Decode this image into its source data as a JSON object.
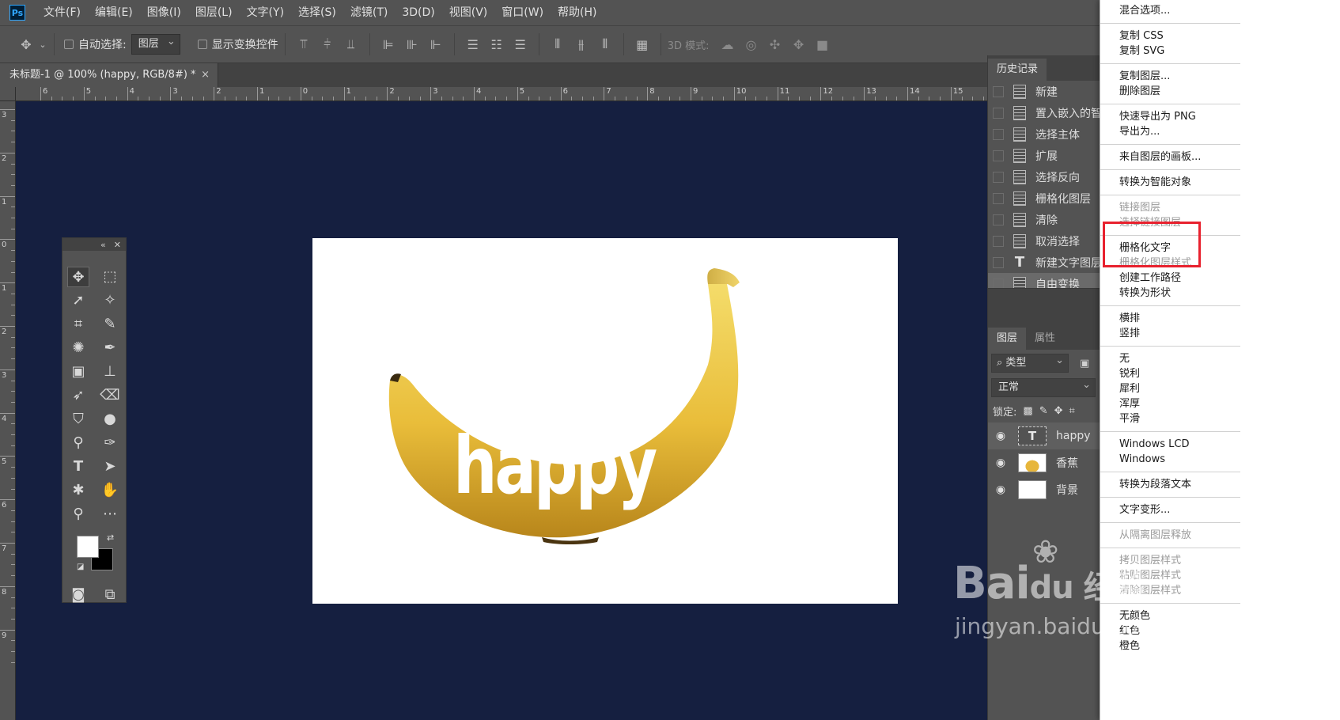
{
  "app": {
    "logo": "Ps"
  },
  "menubar": {
    "items": [
      "文件(F)",
      "编辑(E)",
      "图像(I)",
      "图层(L)",
      "文字(Y)",
      "选择(S)",
      "滤镜(T)",
      "3D(D)",
      "视图(V)",
      "窗口(W)",
      "帮助(H)"
    ]
  },
  "options_bar": {
    "auto_select_label": "自动选择:",
    "auto_select_value": "图层",
    "show_transform_label": "显示变换控件",
    "mode_3d_label": "3D 模式:"
  },
  "document": {
    "tab_title": "未标题-1 @ 100% (happy, RGB/8#) *",
    "close_glyph": "×"
  },
  "rulers": {
    "horizontal_labels": [
      "6",
      "5",
      "4",
      "3",
      "2",
      "1",
      "0",
      "1",
      "2",
      "3",
      "4",
      "5",
      "6",
      "7",
      "8",
      "9",
      "10",
      "11",
      "12",
      "13",
      "14",
      "15"
    ],
    "vertical_labels": [
      "3",
      "2",
      "1",
      "0",
      "1",
      "2",
      "3",
      "4",
      "5",
      "6",
      "7",
      "8",
      "9"
    ]
  },
  "canvas": {
    "text_layer_content": "happy",
    "workspace_color": "#151f40"
  },
  "toolbox": {
    "collapse_glyph": "«",
    "close_glyph": "✕",
    "foreground_color": "#ffffff",
    "background_color": "#000000"
  },
  "history_panel": {
    "tab_label": "历史记录",
    "items": [
      {
        "label": "新建",
        "icon": "document-icon"
      },
      {
        "label": "置入嵌入的智",
        "icon": "document-icon"
      },
      {
        "label": "选择主体",
        "icon": "document-icon"
      },
      {
        "label": "扩展",
        "icon": "document-icon"
      },
      {
        "label": "选择反向",
        "icon": "document-icon"
      },
      {
        "label": "栅格化图层",
        "icon": "document-icon"
      },
      {
        "label": "清除",
        "icon": "document-icon"
      },
      {
        "label": "取消选择",
        "icon": "document-icon"
      },
      {
        "label": "新建文字图层",
        "icon": "type-icon"
      },
      {
        "label": "自由变换",
        "icon": "document-icon"
      }
    ]
  },
  "layers_panel": {
    "tabs": [
      "图层",
      "属性"
    ],
    "filter_label": "类型",
    "blend_mode": "正常",
    "lock_label": "锁定:",
    "layers": [
      {
        "name": "happy",
        "type": "text"
      },
      {
        "name": "香蕉",
        "type": "image"
      },
      {
        "name": "背景",
        "type": "background"
      }
    ]
  },
  "context_menu": {
    "groups": [
      [
        {
          "label": "混合选项...",
          "enabled": true
        }
      ],
      [
        {
          "label": "复制 CSS",
          "enabled": true
        },
        {
          "label": "复制 SVG",
          "enabled": true
        }
      ],
      [
        {
          "label": "复制图层...",
          "enabled": true
        },
        {
          "label": "删除图层",
          "enabled": true
        }
      ],
      [
        {
          "label": "快速导出为 PNG",
          "enabled": true
        },
        {
          "label": "导出为...",
          "enabled": true
        }
      ],
      [
        {
          "label": "来自图层的画板...",
          "enabled": true
        }
      ],
      [
        {
          "label": "转换为智能对象",
          "enabled": true
        }
      ],
      [
        {
          "label": "链接图层",
          "enabled": false
        },
        {
          "label": "选择链接图层",
          "enabled": false
        }
      ],
      [
        {
          "label": "栅格化文字",
          "enabled": true
        },
        {
          "label": "栅格化图层样式",
          "enabled": false
        },
        {
          "label": "创建工作路径",
          "enabled": true
        },
        {
          "label": "转换为形状",
          "enabled": true
        }
      ],
      [
        {
          "label": "横排",
          "enabled": true
        },
        {
          "label": "竖排",
          "enabled": true
        }
      ],
      [
        {
          "label": "无",
          "enabled": true
        },
        {
          "label": "锐利",
          "enabled": true
        },
        {
          "label": "犀利",
          "enabled": true
        },
        {
          "label": "浑厚",
          "enabled": true
        },
        {
          "label": "平滑",
          "enabled": true
        }
      ],
      [
        {
          "label": "Windows LCD",
          "enabled": true
        },
        {
          "label": "Windows",
          "enabled": true
        }
      ],
      [
        {
          "label": "转换为段落文本",
          "enabled": true
        }
      ],
      [
        {
          "label": "文字变形...",
          "enabled": true
        }
      ],
      [
        {
          "label": "从隔离图层释放",
          "enabled": false
        }
      ],
      [
        {
          "label": "拷贝图层样式",
          "enabled": false
        },
        {
          "label": "粘贴图层样式",
          "enabled": false
        },
        {
          "label": "清除图层样式",
          "enabled": false
        }
      ],
      [
        {
          "label": "无颜色",
          "enabled": true
        },
        {
          "label": "红色",
          "enabled": true
        },
        {
          "label": "橙色",
          "enabled": true
        }
      ]
    ],
    "highlight_color": "#e8212e"
  },
  "watermark": {
    "brand": "Bai",
    "brand_suffix": "du 经验",
    "url": "jingyan.baidu.com"
  }
}
